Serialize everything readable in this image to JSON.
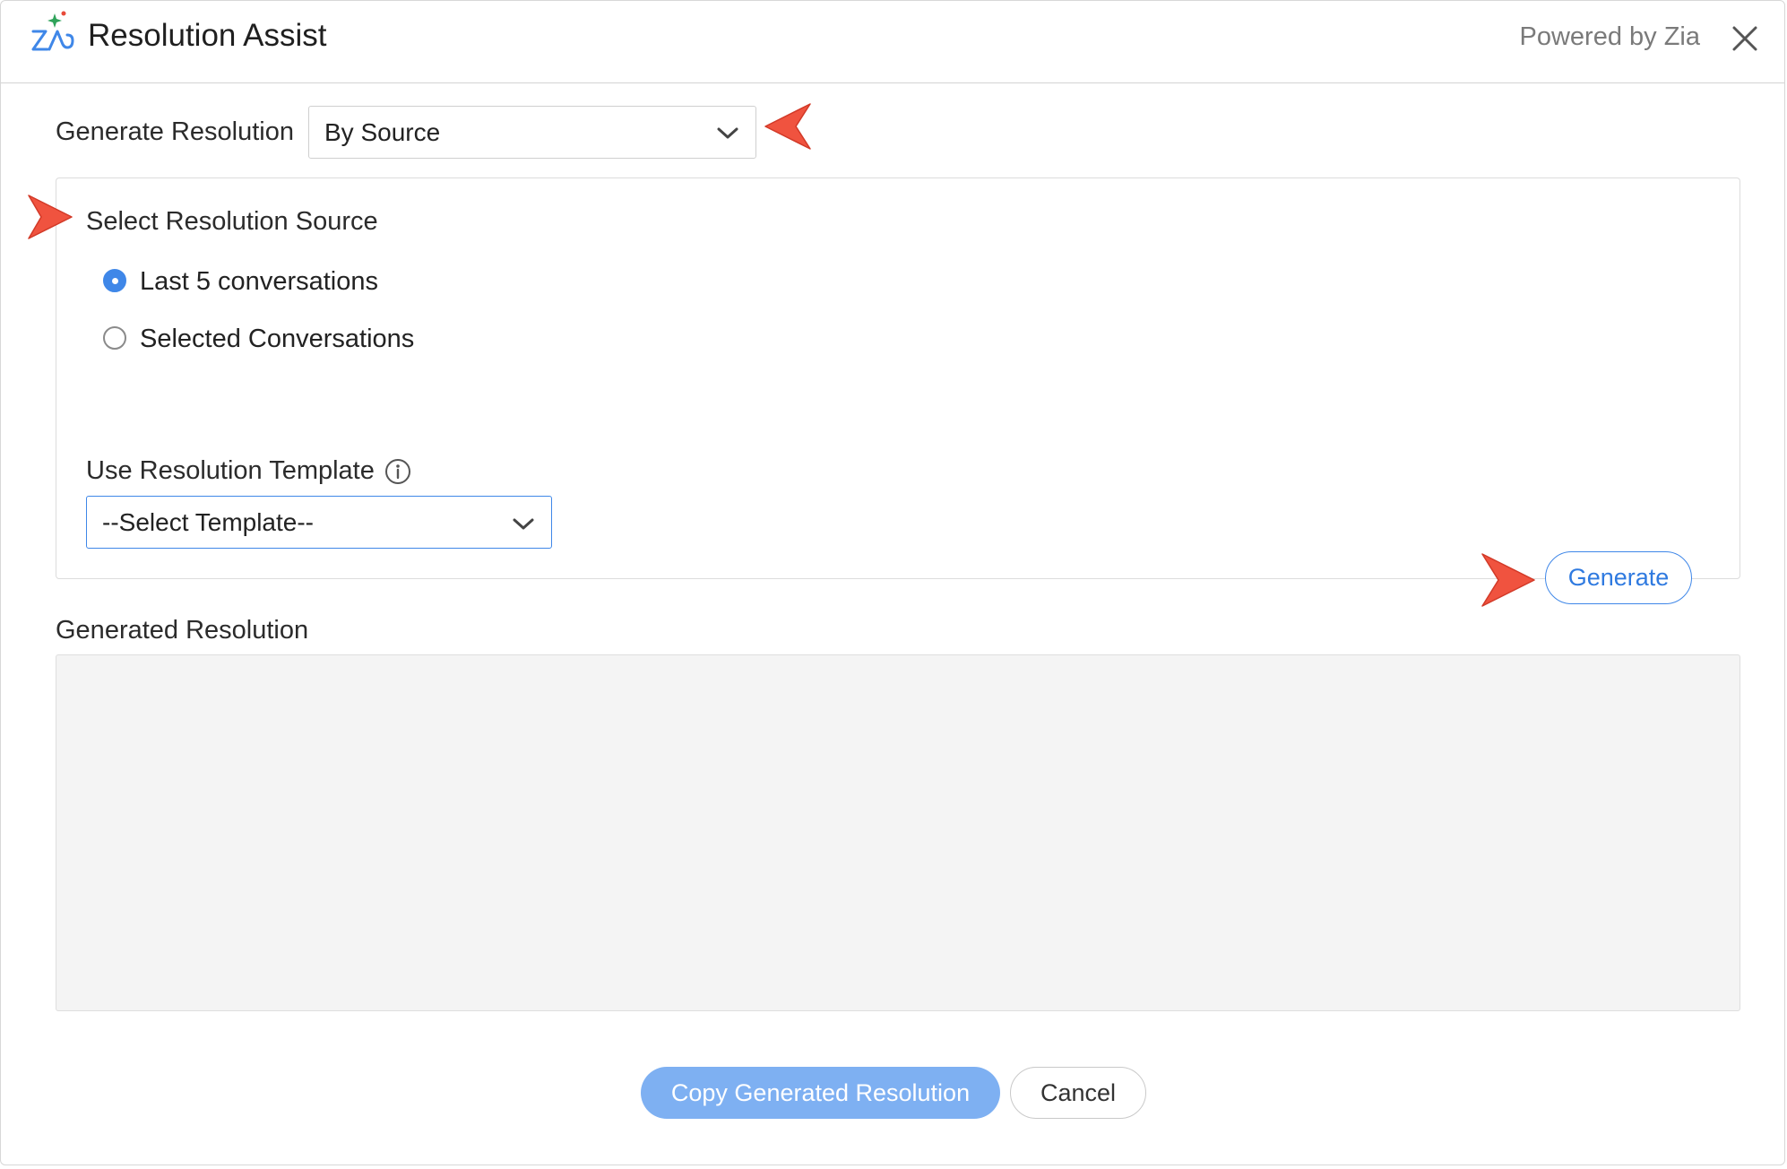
{
  "header": {
    "title": "Resolution Assist",
    "powered_by": "Powered by Zia"
  },
  "generate_resolution": {
    "label": "Generate Resolution",
    "selected": "By Source"
  },
  "source": {
    "title": "Select Resolution Source",
    "options": [
      {
        "label": "Last 5 conversations",
        "selected": true
      },
      {
        "label": "Selected Conversations",
        "selected": false
      }
    ]
  },
  "template": {
    "label": "Use Resolution Template",
    "selected": "--Select Template--"
  },
  "generate_button": "Generate",
  "generated": {
    "label": "Generated Resolution",
    "value": ""
  },
  "footer": {
    "copy_label": "Copy Generated Resolution",
    "cancel_label": "Cancel"
  },
  "colors": {
    "accent": "#3f87e8",
    "copy_button": "#7eb0f2",
    "annotation_arrow": "#f0533f",
    "generated_bg": "#f4f4f4"
  }
}
